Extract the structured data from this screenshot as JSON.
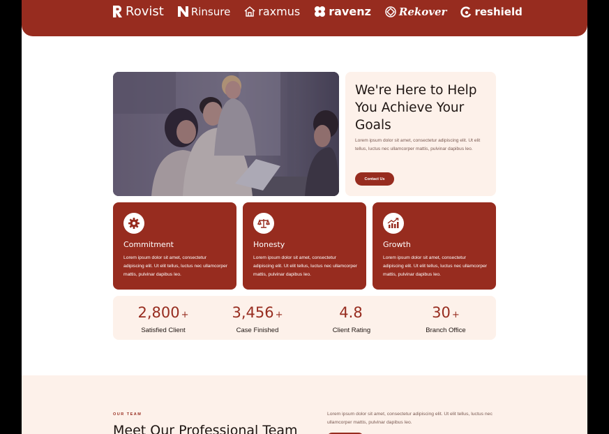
{
  "brand_logos": [
    {
      "name": "Rovist",
      "icon": "r-mark-icon"
    },
    {
      "name": "Rinsure",
      "icon": "n-mark-icon"
    },
    {
      "name": "raxmus",
      "icon": "house-icon"
    },
    {
      "name": "ravenz",
      "icon": "clover-icon"
    },
    {
      "name": "Rekover",
      "icon": "diamond-knot-icon"
    },
    {
      "name": "reshield",
      "icon": "c-swirl-icon"
    }
  ],
  "hero": {
    "image": "office-team-meeting-photo",
    "title": "We're Here to Help You Achieve Your Goals",
    "text": "Lorem ipsum dolor sit amet, consectetur adipiscing elit. Ut elit tellus, luctus nec ullamcorper mattis, pulvinar dapibus leo.",
    "button": "Contact Us"
  },
  "values": [
    {
      "icon": "gear-icon",
      "title": "Commitment",
      "text": "Lorem ipsum dolor sit amet, consectetur adipiscing elit. Ut elit tellus, luctus nec ullamcorper mattis, pulvinar dapibus leo."
    },
    {
      "icon": "scale-icon",
      "title": "Honesty",
      "text": "Lorem ipsum dolor sit amet, consectetur adipiscing elit. Ut elit tellus, luctus nec ullamcorper mattis, pulvinar dapibus leo."
    },
    {
      "icon": "growth-chart-icon",
      "title": "Growth",
      "text": "Lorem ipsum dolor sit amet, consectetur adipiscing elit. Ut elit tellus, luctus nec ullamcorper mattis, pulvinar dapibus leo."
    }
  ],
  "stats": [
    {
      "value": "2,800",
      "suffix": "+",
      "label": "Satisfied Client"
    },
    {
      "value": "3,456",
      "suffix": "+",
      "label": "Case Finished"
    },
    {
      "value": "4.8",
      "suffix": "",
      "label": "Client Rating"
    },
    {
      "value": "30",
      "suffix": "+",
      "label": "Branch Office"
    }
  ],
  "team": {
    "eyebrow": "OUR TEAM",
    "title": "Meet Our Professional Team",
    "text": "Lorem ipsum dolor sit amet, consectetur adipiscing elit. Ut elit tellus, luctus nec ullamcorper mattis, pulvinar dapibus leo."
  },
  "colors": {
    "accent": "#972c1f",
    "cream": "#fdf1ea",
    "text_dark": "#1e1512",
    "text_muted": "#7a5a52"
  }
}
